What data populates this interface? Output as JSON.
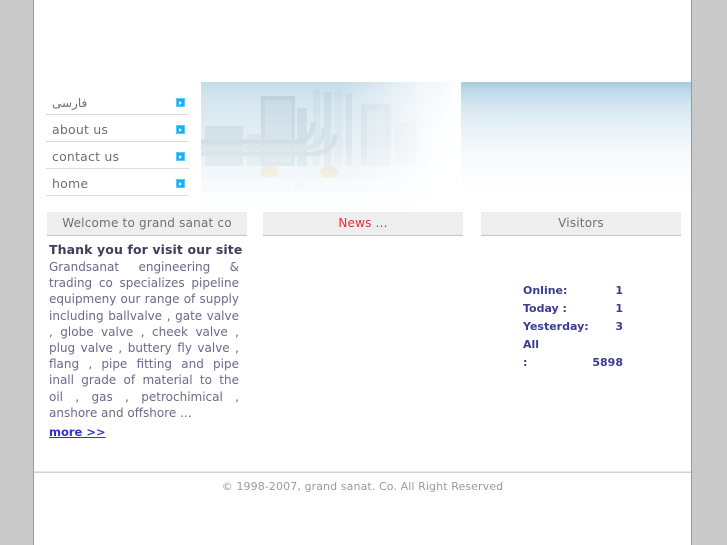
{
  "site": {
    "background_color": "#c9c9c9",
    "content_background": "#ffffff"
  },
  "nav": {
    "items": [
      {
        "label": "فارسی",
        "rtl": true,
        "icon": "arrow-bullet-icon"
      },
      {
        "label": "about us",
        "rtl": false,
        "icon": "arrow-bullet-icon"
      },
      {
        "label": "contact us",
        "rtl": false,
        "icon": "arrow-bullet-icon"
      },
      {
        "label": "home",
        "rtl": false,
        "icon": "arrow-bullet-icon"
      }
    ]
  },
  "banner": {
    "alt": "industrial refinery piping photo",
    "sky_color": "#a8c9de"
  },
  "panels": {
    "welcome": {
      "heading": "Welcome to grand sanat co",
      "title": "Thank you for visit our site",
      "body": "Grandsanat engineering & trading co specializes pipeline equipmeny our range of supply including ballvalve , gate valve , globe valve , cheek valve , plug valve , buttery fly valve , flang , pipe fitting and pipe inall grade of material to the oil , gas , petrochimical , anshore and offshore ...",
      "more_label": "more >>"
    },
    "news": {
      "heading": "News ...",
      "heading_color": "#e03030"
    },
    "visitors": {
      "heading": "Visitors",
      "rows": [
        {
          "label": "Online:",
          "value": "1"
        },
        {
          "label": "Today :",
          "value": "1"
        },
        {
          "label": "Yesterday:",
          "value": "3"
        }
      ],
      "all_label": "All",
      "all_colon": ":",
      "all_value": "5898"
    }
  },
  "footer": {
    "copyright": "© 1998-2007, grand sanat. Co. All Right Reserved"
  }
}
